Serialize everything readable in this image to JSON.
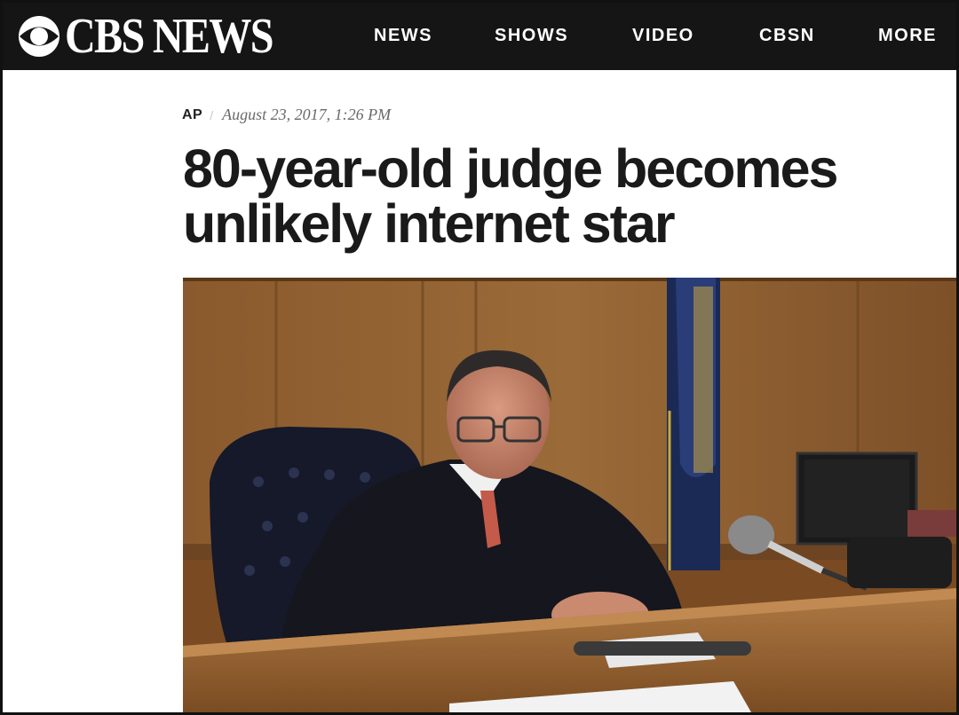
{
  "site": {
    "logo_text": "CBS NEWS"
  },
  "nav": {
    "items": [
      "NEWS",
      "SHOWS",
      "VIDEO",
      "CBSN",
      "MORE"
    ]
  },
  "article": {
    "source": "AP",
    "date": "August 23, 2017, 1:26 PM",
    "headline_line1": "80-year-old judge becomes",
    "headline_line2": "unlikely internet star"
  },
  "colors": {
    "header_bg": "#151515",
    "headline": "#1a1a1a",
    "date": "#6a6a6a"
  }
}
